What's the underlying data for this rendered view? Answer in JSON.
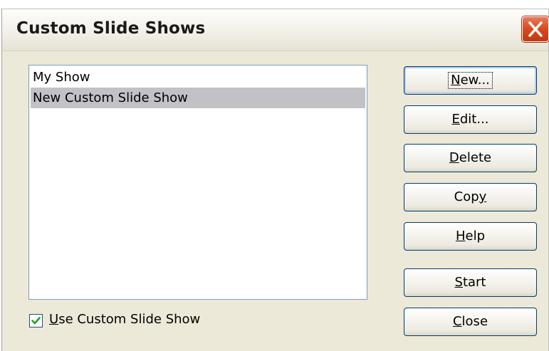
{
  "dialog": {
    "title": "Custom Slide Shows"
  },
  "list": {
    "items": [
      {
        "label": "My Show",
        "selected": false
      },
      {
        "label": "New Custom Slide Show",
        "selected": true
      }
    ]
  },
  "checkbox": {
    "label_mnemonic": "U",
    "label_rest": "se Custom Slide Show",
    "checked": true
  },
  "buttons": {
    "new": {
      "mnemonic": "N",
      "rest": "ew..."
    },
    "edit": {
      "mnemonic": "E",
      "rest": "dit..."
    },
    "delete": {
      "mnemonic": "D",
      "rest": "elete"
    },
    "copy": {
      "before": "Cop",
      "mnemonic": "y"
    },
    "help": {
      "mnemonic": "H",
      "rest": "elp"
    },
    "start": {
      "mnemonic": "S",
      "rest": "tart"
    },
    "close": {
      "mnemonic": "C",
      "rest": "lose"
    }
  },
  "colors": {
    "dialog_bg": "#ece9d8",
    "selection": "#c2c1c5",
    "close_button": "#d64a1e",
    "check": "#21a121"
  },
  "icons": {
    "close": "close-x-icon",
    "check": "checkmark-icon"
  }
}
